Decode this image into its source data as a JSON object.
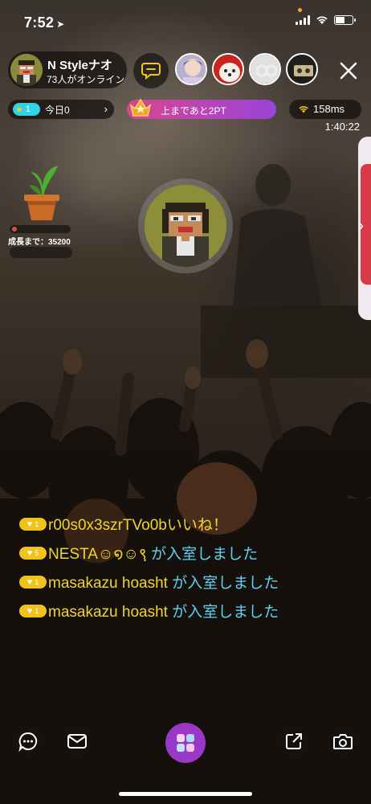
{
  "status_bar": {
    "time": "7:52",
    "location_glyph": "➤"
  },
  "host": {
    "name": "N Styleナオ",
    "online_text": "73人がオンライン"
  },
  "viewers": [
    "viewer-1",
    "viewer-2",
    "viewer-3",
    "viewer-4"
  ],
  "level": {
    "badge": "1",
    "text": "今日0",
    "chevron": "›"
  },
  "rank": {
    "text": "上まであと2PT"
  },
  "ping": {
    "text": "158ms"
  },
  "elapsed": "1:40:22",
  "plant": {
    "text": "成長まで：35200"
  },
  "messages": [
    {
      "badge": "1",
      "name": "r00s0x3szrTVo0b",
      "text": "いいね！"
    },
    {
      "badge": "5",
      "name": "NESTA☺︎໑☺︎९ฺ ",
      "text": "が入室しました"
    },
    {
      "badge": "1",
      "name": "masakazu hoasht",
      "text": " が入室しました"
    },
    {
      "badge": "1",
      "name": "masakazu hoasht",
      "text": " が入室しました"
    }
  ],
  "colors": {
    "username": "#f0d62a",
    "system_text": "#5fd0f0",
    "level_badge": "#2fd2e6",
    "rank_gradient_start": "#d7468f",
    "rank_gradient_end": "#9a44d9",
    "center_button": "#9b37c7",
    "message_badge": "#f1c21a"
  },
  "icons": {
    "chat": "chat-bubble-icon",
    "mail": "mail-icon",
    "apps": "apps-icon",
    "share": "share-icon",
    "camera": "camera-icon",
    "close": "close-icon"
  }
}
